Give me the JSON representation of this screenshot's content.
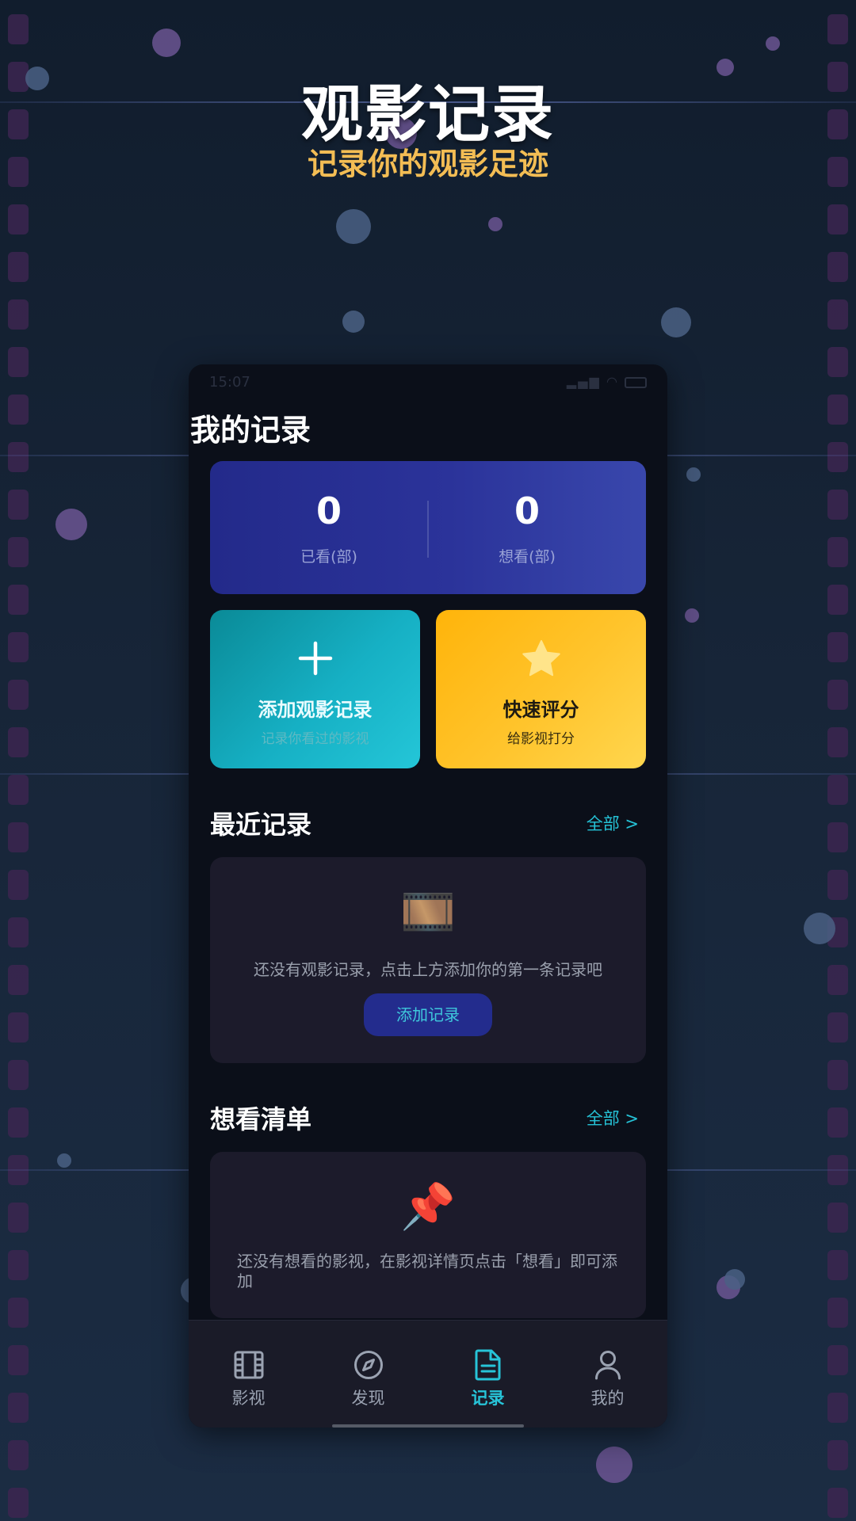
{
  "hero": {
    "title": "观影记录",
    "subtitle": "记录你的观影足迹"
  },
  "status_bar": {
    "time": "15:07"
  },
  "page": {
    "title": "我的记录"
  },
  "stats": {
    "watched_value": "0",
    "watched_label": "已看(部)",
    "want_value": "0",
    "want_label": "想看(部)"
  },
  "actions": {
    "add": {
      "icon": "plus-icon",
      "title": "添加观影记录",
      "subtitle": "记录你看过的影视"
    },
    "rate": {
      "icon": "star-icon",
      "title": "快速评分",
      "subtitle": "给影视打分"
    }
  },
  "recent": {
    "title": "最近记录",
    "link": "全部 >",
    "empty_icon": "film-frame-icon",
    "empty_emoji": "🎞️",
    "empty_text": "还没有观影记录，点击上方添加你的第一条记录吧",
    "button": "添加记录"
  },
  "wishlist": {
    "title": "想看清单",
    "link": "全部 >",
    "empty_icon": "pushpin-icon",
    "empty_emoji": "📌",
    "empty_text": "还没有想看的影视，在影视详情页点击「想看」即可添加"
  },
  "tab_bar": {
    "items": [
      {
        "label": "影视",
        "icon": "film-icon",
        "active": false
      },
      {
        "label": "发现",
        "icon": "compass-icon",
        "active": false
      },
      {
        "label": "记录",
        "icon": "document-icon",
        "active": true
      },
      {
        "label": "我的",
        "icon": "user-icon",
        "active": false
      }
    ]
  },
  "colors": {
    "accent": "#27c4d8",
    "stats_card": "#2b339a",
    "add_card": "#16b0c4",
    "rate_card": "#ffc42c",
    "hero_subtitle": "#f3bd54"
  }
}
